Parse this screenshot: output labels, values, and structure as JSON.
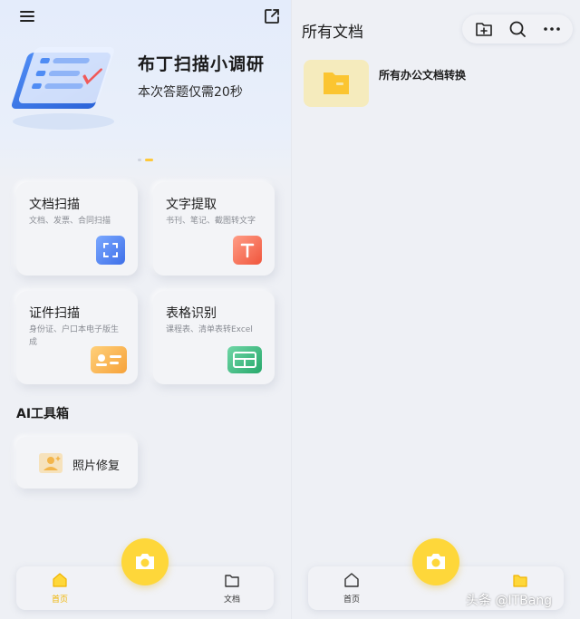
{
  "left": {
    "banner": {
      "title": "布丁扫描小调研",
      "subtitle": "本次答题仅需20秒"
    },
    "cards": [
      {
        "title": "文档扫描",
        "subtitle": "文档、发票、合同扫描"
      },
      {
        "title": "文字提取",
        "subtitle": "书刊、笔记、截图转文字"
      },
      {
        "title": "证件扫描",
        "subtitle": "身份证、户口本电子版生成"
      },
      {
        "title": "表格识别",
        "subtitle": "课程表、清单表转Excel"
      }
    ],
    "ai_section_title": "AI工具箱",
    "ai_tool": {
      "label": "照片修复"
    },
    "nav": {
      "home_label": "首页",
      "docs_label": "文档"
    }
  },
  "right": {
    "title": "所有文档",
    "folder": {
      "name": "所有办公文档转换"
    },
    "nav": {
      "home_label": "首页"
    }
  },
  "watermark": "头条 @ITBang",
  "colors": {
    "accent": "#fed73a",
    "home_active": "#f0b400"
  }
}
